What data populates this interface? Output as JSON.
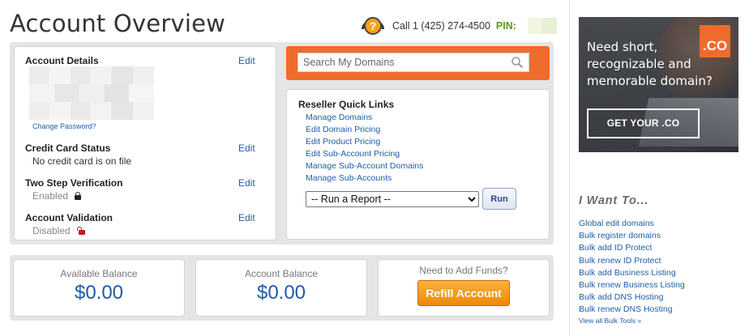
{
  "page": {
    "title": "Account Overview"
  },
  "support": {
    "phone": "Call 1 (425) 274-4500",
    "pin_label": "PIN:"
  },
  "account": {
    "details_title": "Account Details",
    "edit_label": "Edit",
    "change_password": "Change Password?",
    "credit_card_title": "Credit Card Status",
    "credit_card_status": "No credit card is on file",
    "two_step_title": "Two Step Verification",
    "two_step_status": "Enabled",
    "validation_title": "Account Validation",
    "validation_status": "Disabled"
  },
  "search": {
    "placeholder": "Search My Domains"
  },
  "quick_links": {
    "title": "Reseller Quick Links",
    "items": [
      "Manage Domains",
      "Edit Domain Pricing",
      "Edit Product Pricing",
      "Edit Sub-Account Pricing",
      "Manage Sub-Account Domains",
      "Manage Sub-Accounts"
    ],
    "report_selected": "-- Run a Report --",
    "run_label": "Run"
  },
  "balances": {
    "available_label": "Available Balance",
    "available_value": "$0.00",
    "account_label": "Account Balance",
    "account_value": "$0.00",
    "funds_label": "Need to Add Funds?",
    "refill_label": "Refill Account"
  },
  "ad": {
    "badge": ".CO",
    "headline": "Need short, recognizable and memorable domain?",
    "cta": "GET YOUR .CO"
  },
  "sidebar": {
    "title": "I Want To...",
    "items": [
      "Global edit domains",
      "Bulk register domains",
      "Bulk add ID Protect",
      "Bulk renew ID Protect",
      "Bulk add Business Listing",
      "Bulk renew Business Listing",
      "Bulk add DNS Hosting",
      "Bulk renew DNS Hosting"
    ],
    "view_all": "View all Bulk Tools »"
  },
  "colors": {
    "accent_orange": "#ef6b2c",
    "link_blue": "#1d5fa8",
    "pin_green": "#5f9a16",
    "refill_orange": "#f29a1a"
  },
  "icons": [
    "support-headset-icon",
    "search-icon",
    "lock-icon",
    "unlock-icon",
    "dropdown-arrow-icon"
  ]
}
